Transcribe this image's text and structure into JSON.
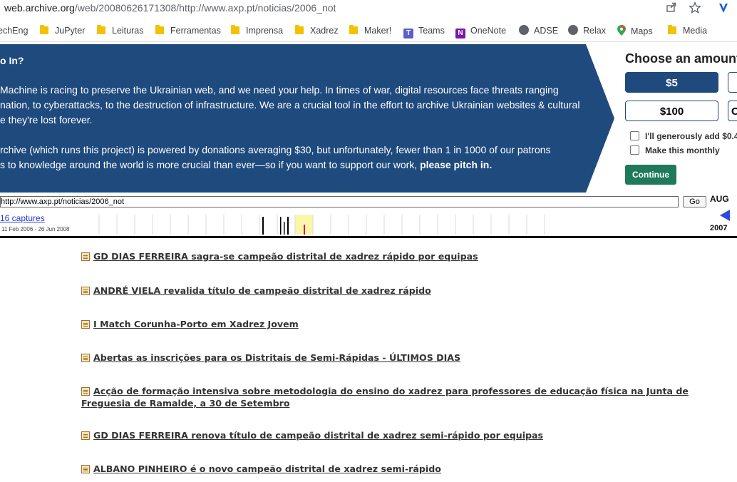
{
  "browser": {
    "url_domain": "web.archive.org",
    "url_path": "/web/20080626171308/http://www.axp.pt/noticias/2006_not",
    "bookmarks": [
      {
        "label": "echEng",
        "icon": "folder-icon"
      },
      {
        "label": "JuPyter",
        "icon": "folder-icon"
      },
      {
        "label": "Leituras",
        "icon": "folder-icon"
      },
      {
        "label": "Ferramentas",
        "icon": "folder-icon"
      },
      {
        "label": "Imprensa",
        "icon": "folder-icon"
      },
      {
        "label": "Xadrez",
        "icon": "folder-icon"
      },
      {
        "label": "Maker!",
        "icon": "folder-icon"
      },
      {
        "label": "Teams",
        "icon": "teams-icon"
      },
      {
        "label": "OneNote",
        "icon": "onenote-icon"
      },
      {
        "label": "ADSE",
        "icon": "globe-icon"
      },
      {
        "label": "Relax",
        "icon": "globe-icon"
      },
      {
        "label": "Maps",
        "icon": "maps-pin-icon"
      },
      {
        "label": "Media",
        "icon": "folder-icon"
      }
    ]
  },
  "banner": {
    "heading": "o In?",
    "p1_line1": " Machine is racing to preserve the Ukrainian web, and we need your help. In times of war, digital resources face threats ranging",
    "p1_line2": "nation, to cyberattacks, to the destruction of infrastructure. We are a crucial tool in the effort to archive Ukrainian websites & cultural",
    "p1_line3": "e they're lost forever.",
    "p2_line1": "rchive (which runs this project) is powered by donations averaging $30, but unfortunately, fewer than 1 in 1000 of our patrons",
    "p2_line2": "s to knowledge around the world is more crucial than ever—so if you want to support our work, ",
    "p2_bold": "please pitch in.",
    "choose_label": "Choose an amount",
    "amounts": [
      "$5",
      "$100",
      "C"
    ],
    "fees_label": "I'll generously add $0.4",
    "monthly_label": "Make this monthly",
    "continue_label": "Continue"
  },
  "wayback": {
    "url_value": "http://www.axp.pt/noticias/2006_not",
    "go_label": "Go",
    "captures_label": "16 captures",
    "range_label": "11 Feb 2006 - 26 Jun 2008",
    "month_label": "AUG",
    "year_label": "2007"
  },
  "news": [
    "GD DIAS FERREIRA sagra-se campeão distrital de xadrez rápido por equipas",
    "ANDRÉ VIELA revalida título de campeão distrital de xadrez rápido",
    "I Match Corunha-Porto em Xadrez Jovem",
    "Abertas as inscrições para os Distritais de Semi-Rápidas - ÚLTIMOS DIAS",
    "Acção de formação intensiva sobre metodologia do ensino do xadrez para professores de educação física na Junta de Freguesia de Ramalde, a 30 de Setembro",
    "GD DIAS FERREIRA renova título de campeão distrital de xadrez semi-rápido por equipas",
    "ALBANO PINHEIRO é o novo campeão distrital de xadrez semi-rápido"
  ],
  "colors": {
    "banner_blue": "#1f4a7d",
    "continue_green": "#1e7a5a",
    "captures_link": "#2a3bd6",
    "sparkline_highlight": "#fbf7a8",
    "sparkline_current": "#e0124a"
  }
}
